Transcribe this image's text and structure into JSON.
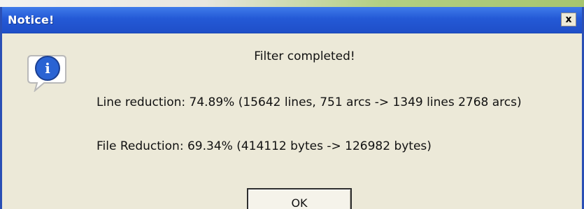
{
  "window": {
    "title": "Notice!",
    "close_glyph": "x",
    "title_bar_color": "#2459d6"
  },
  "message": {
    "headline": "Filter completed!",
    "line_reduction": "Line reduction: 74.89% (15642 lines, 751 arcs -> 1349 lines 2768 arcs)",
    "file_reduction": "File Reduction: 69.34% (414112 bytes -> 126982 bytes)"
  },
  "icon": {
    "name": "info-icon",
    "glyph": "i"
  },
  "buttons": {
    "ok_label": "OK"
  }
}
